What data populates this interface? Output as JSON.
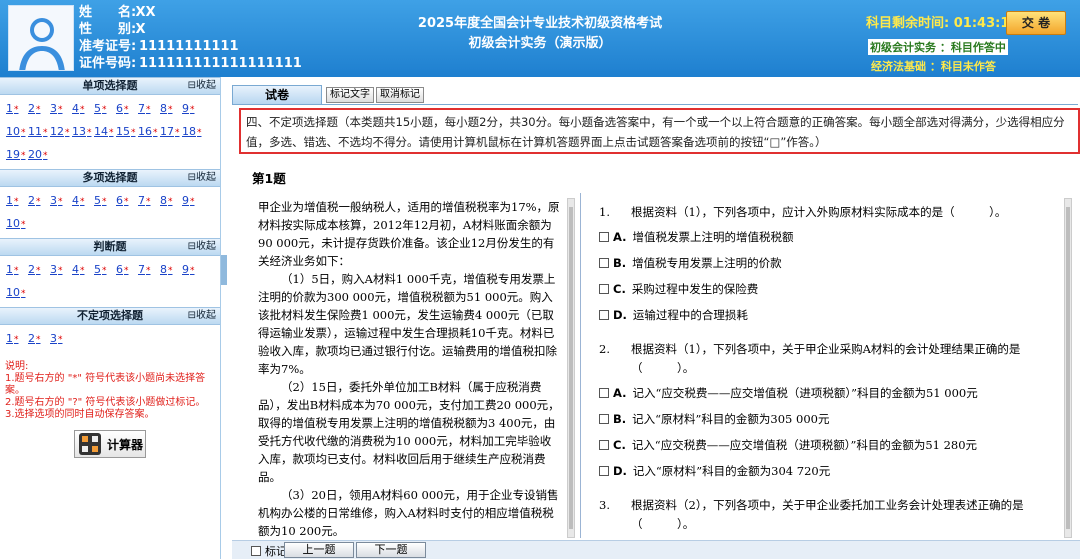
{
  "candidate": {
    "name_label": "姓　　名:",
    "name": "XX",
    "gender_label": "性　　别:",
    "gender": "X",
    "ticket_label": "准考证号:",
    "ticket": "11111111111",
    "id_label": "证件号码:",
    "id": "111111111111111111"
  },
  "exam": {
    "title_line1": "2025年度全国会计专业技术初级资格考试",
    "title_line2": "初级会计实务（演示版）",
    "timer_label": "科目剩余时间:",
    "timer_value": "01:43:16",
    "submit_label": "交 卷",
    "subject1": "初级会计实务  ：科目作答中",
    "subject2": "经济法基础  ：科目未作答"
  },
  "sidebar": {
    "collapse_label": "⊟收起",
    "sections": [
      {
        "title": "单项选择题",
        "rows": [
          [
            "1",
            "2",
            "3",
            "4",
            "5",
            "6",
            "7",
            "8",
            "9"
          ],
          [
            "10",
            "11",
            "12",
            "13",
            "14",
            "15",
            "16",
            "17",
            "18"
          ],
          [
            "19",
            "20"
          ]
        ]
      },
      {
        "title": "多项选择题",
        "rows": [
          [
            "1",
            "2",
            "3",
            "4",
            "5",
            "6",
            "7",
            "8",
            "9"
          ],
          [
            "10"
          ]
        ]
      },
      {
        "title": "判断题",
        "rows": [
          [
            "1",
            "2",
            "3",
            "4",
            "5",
            "6",
            "7",
            "8",
            "9"
          ],
          [
            "10"
          ]
        ]
      },
      {
        "title": "不定项选择题",
        "rows": [
          [
            "1",
            "2",
            "3"
          ]
        ]
      }
    ],
    "star": "*",
    "notes": [
      "说明:",
      "1.题号右方的 \"*\" 符号代表该小题尚未选择答案。",
      "2.题号右方的 \"?\" 符号代表该小题做过标记。",
      "3.选择选项的同时自动保存答案。"
    ],
    "calculator_label": "计算器"
  },
  "tabs": {
    "main": "试卷",
    "mark_text": "标记文字",
    "unmark": "取消标记"
  },
  "instruction": "四、不定项选择题（本类题共15小题，每小题2分，共30分。每小题备选答案中，有一个或一个以上符合题意的正确答案。每小题全部选对得满分，少选得相应分值，多选、错选、不选均不得分。请使用计算机鼠标在计算机答题界面上点击试题答案备选项前的按钮“□”作答。）",
  "question_title": "第1题",
  "material": [
    "甲企业为增值税一般纳税人，适用的增值税税率为17%，原材料按实际成本核算，2012年12月初，A材料账面余额为90 000元，未计提存货跌价准备。该企业12月份发生的有关经济业务如下：",
    "（1）5日，购入A材料1 000千克，增值税专用发票上注明的价款为300 000元，增值税税额为51 000元。购入该批材料发生保险费1 000元，发生运输费4 000元（已取得运输业发票），运输过程中发生合理损耗10千克。材料已验收入库，款项均已通过银行付讫。运输费用的增值税扣除率为7%。",
    "（2）15日，委托外单位加工B材料（属于应税消费品），发出B材料成本为70 000元，支付加工费20 000元，取得的增值税专用发票上注明的增值税税额为3 400元，由受托方代收代缴的消费税为10 000元，材料加工完毕验收入库，款项均已支付。材料收回后用于继续生产应税消费品。",
    "（3）20日，领用A材料60 000元，用于企业专设销售机构办公楼的日常维修，购入A材料时支付的相应增值税税额为10 200元。"
  ],
  "questions": [
    {
      "num": "1.",
      "stem": "根据资料（1），下列各项中，应计入外购原材料实际成本的是（　　　）。",
      "options": [
        [
          "A.",
          "增值税发票上注明的增值税税额"
        ],
        [
          "B.",
          "增值税专用发票上注明的价款"
        ],
        [
          "C.",
          "采购过程中发生的保险费"
        ],
        [
          "D.",
          "运输过程中的合理损耗"
        ]
      ]
    },
    {
      "num": "2.",
      "stem": "根据资料（1），下列各项中，关于甲企业采购A材料的会计处理结果正确的是（　　　）。",
      "options": [
        [
          "A.",
          "记入“应交税费——应交增值税（进项税额）”科目的金额为51 000元"
        ],
        [
          "B.",
          "记入“原材料”科目的金额为305 000元"
        ],
        [
          "C.",
          "记入“应交税费——应交增值税（进项税额）”科目的金额为51 280元"
        ],
        [
          "D.",
          "记入“原材料”科目的金额为304 720元"
        ]
      ]
    },
    {
      "num": "3.",
      "stem": "根据资料（2），下列各项中，关于甲企业委托加工业务会计处理表述正确的是（　　　）。",
      "options": []
    }
  ],
  "footer": {
    "mark_label": "标记",
    "prev_label": "上一题",
    "next_label": "下一题"
  }
}
